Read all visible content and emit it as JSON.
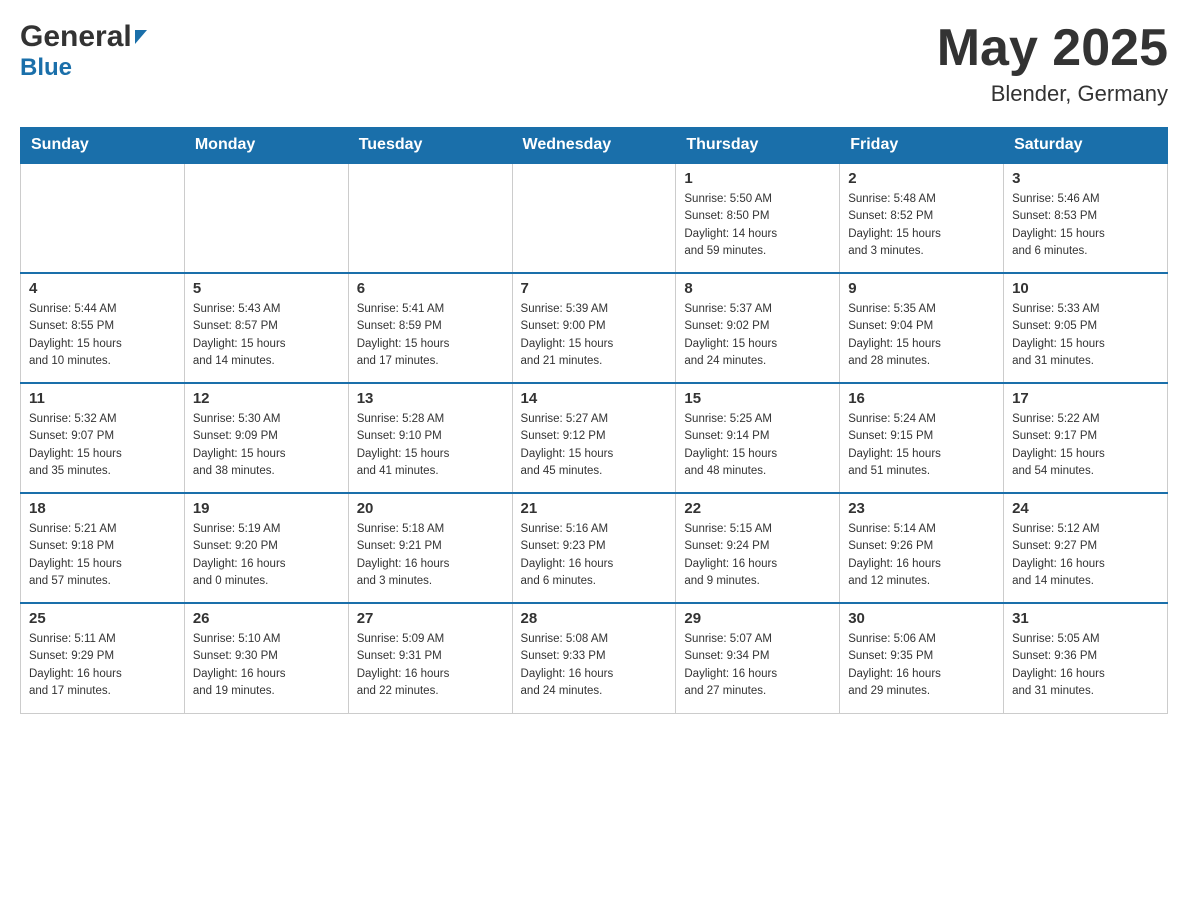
{
  "header": {
    "logo_general": "General",
    "logo_blue": "Blue",
    "month_year": "May 2025",
    "location": "Blender, Germany"
  },
  "weekdays": [
    "Sunday",
    "Monday",
    "Tuesday",
    "Wednesday",
    "Thursday",
    "Friday",
    "Saturday"
  ],
  "weeks": [
    [
      {
        "day": "",
        "info": ""
      },
      {
        "day": "",
        "info": ""
      },
      {
        "day": "",
        "info": ""
      },
      {
        "day": "",
        "info": ""
      },
      {
        "day": "1",
        "info": "Sunrise: 5:50 AM\nSunset: 8:50 PM\nDaylight: 14 hours\nand 59 minutes."
      },
      {
        "day": "2",
        "info": "Sunrise: 5:48 AM\nSunset: 8:52 PM\nDaylight: 15 hours\nand 3 minutes."
      },
      {
        "day": "3",
        "info": "Sunrise: 5:46 AM\nSunset: 8:53 PM\nDaylight: 15 hours\nand 6 minutes."
      }
    ],
    [
      {
        "day": "4",
        "info": "Sunrise: 5:44 AM\nSunset: 8:55 PM\nDaylight: 15 hours\nand 10 minutes."
      },
      {
        "day": "5",
        "info": "Sunrise: 5:43 AM\nSunset: 8:57 PM\nDaylight: 15 hours\nand 14 minutes."
      },
      {
        "day": "6",
        "info": "Sunrise: 5:41 AM\nSunset: 8:59 PM\nDaylight: 15 hours\nand 17 minutes."
      },
      {
        "day": "7",
        "info": "Sunrise: 5:39 AM\nSunset: 9:00 PM\nDaylight: 15 hours\nand 21 minutes."
      },
      {
        "day": "8",
        "info": "Sunrise: 5:37 AM\nSunset: 9:02 PM\nDaylight: 15 hours\nand 24 minutes."
      },
      {
        "day": "9",
        "info": "Sunrise: 5:35 AM\nSunset: 9:04 PM\nDaylight: 15 hours\nand 28 minutes."
      },
      {
        "day": "10",
        "info": "Sunrise: 5:33 AM\nSunset: 9:05 PM\nDaylight: 15 hours\nand 31 minutes."
      }
    ],
    [
      {
        "day": "11",
        "info": "Sunrise: 5:32 AM\nSunset: 9:07 PM\nDaylight: 15 hours\nand 35 minutes."
      },
      {
        "day": "12",
        "info": "Sunrise: 5:30 AM\nSunset: 9:09 PM\nDaylight: 15 hours\nand 38 minutes."
      },
      {
        "day": "13",
        "info": "Sunrise: 5:28 AM\nSunset: 9:10 PM\nDaylight: 15 hours\nand 41 minutes."
      },
      {
        "day": "14",
        "info": "Sunrise: 5:27 AM\nSunset: 9:12 PM\nDaylight: 15 hours\nand 45 minutes."
      },
      {
        "day": "15",
        "info": "Sunrise: 5:25 AM\nSunset: 9:14 PM\nDaylight: 15 hours\nand 48 minutes."
      },
      {
        "day": "16",
        "info": "Sunrise: 5:24 AM\nSunset: 9:15 PM\nDaylight: 15 hours\nand 51 minutes."
      },
      {
        "day": "17",
        "info": "Sunrise: 5:22 AM\nSunset: 9:17 PM\nDaylight: 15 hours\nand 54 minutes."
      }
    ],
    [
      {
        "day": "18",
        "info": "Sunrise: 5:21 AM\nSunset: 9:18 PM\nDaylight: 15 hours\nand 57 minutes."
      },
      {
        "day": "19",
        "info": "Sunrise: 5:19 AM\nSunset: 9:20 PM\nDaylight: 16 hours\nand 0 minutes."
      },
      {
        "day": "20",
        "info": "Sunrise: 5:18 AM\nSunset: 9:21 PM\nDaylight: 16 hours\nand 3 minutes."
      },
      {
        "day": "21",
        "info": "Sunrise: 5:16 AM\nSunset: 9:23 PM\nDaylight: 16 hours\nand 6 minutes."
      },
      {
        "day": "22",
        "info": "Sunrise: 5:15 AM\nSunset: 9:24 PM\nDaylight: 16 hours\nand 9 minutes."
      },
      {
        "day": "23",
        "info": "Sunrise: 5:14 AM\nSunset: 9:26 PM\nDaylight: 16 hours\nand 12 minutes."
      },
      {
        "day": "24",
        "info": "Sunrise: 5:12 AM\nSunset: 9:27 PM\nDaylight: 16 hours\nand 14 minutes."
      }
    ],
    [
      {
        "day": "25",
        "info": "Sunrise: 5:11 AM\nSunset: 9:29 PM\nDaylight: 16 hours\nand 17 minutes."
      },
      {
        "day": "26",
        "info": "Sunrise: 5:10 AM\nSunset: 9:30 PM\nDaylight: 16 hours\nand 19 minutes."
      },
      {
        "day": "27",
        "info": "Sunrise: 5:09 AM\nSunset: 9:31 PM\nDaylight: 16 hours\nand 22 minutes."
      },
      {
        "day": "28",
        "info": "Sunrise: 5:08 AM\nSunset: 9:33 PM\nDaylight: 16 hours\nand 24 minutes."
      },
      {
        "day": "29",
        "info": "Sunrise: 5:07 AM\nSunset: 9:34 PM\nDaylight: 16 hours\nand 27 minutes."
      },
      {
        "day": "30",
        "info": "Sunrise: 5:06 AM\nSunset: 9:35 PM\nDaylight: 16 hours\nand 29 minutes."
      },
      {
        "day": "31",
        "info": "Sunrise: 5:05 AM\nSunset: 9:36 PM\nDaylight: 16 hours\nand 31 minutes."
      }
    ]
  ]
}
